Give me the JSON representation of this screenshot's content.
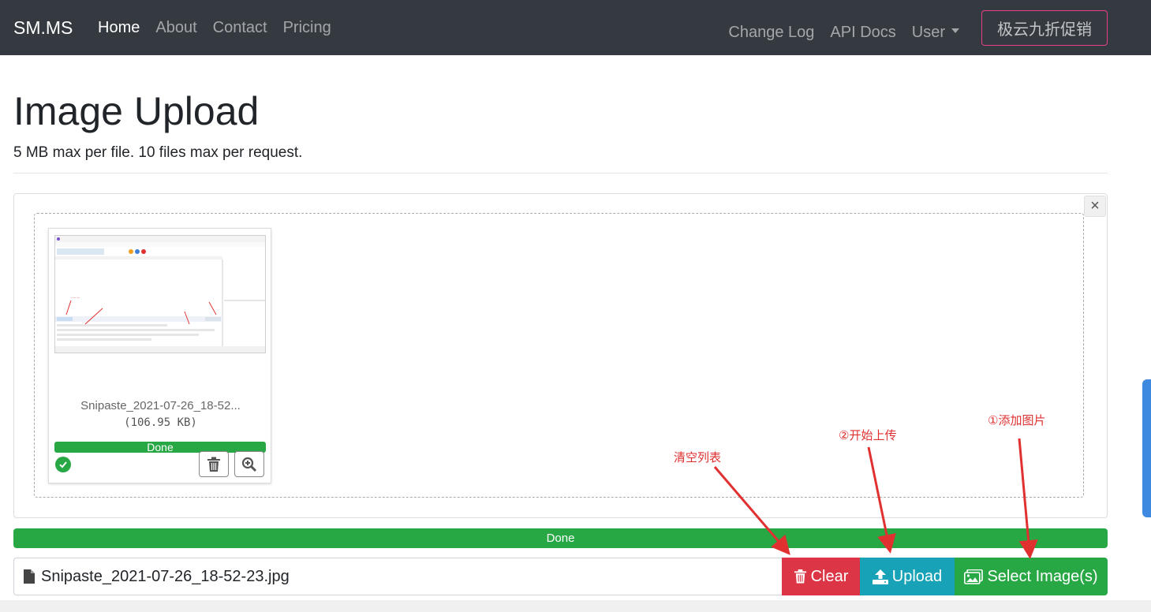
{
  "navbar": {
    "brand": "SM.MS",
    "left_links": [
      "Home",
      "About",
      "Contact",
      "Pricing"
    ],
    "right_links": {
      "changelog": "Change Log",
      "api_docs": "API Docs",
      "user": "User"
    },
    "promo_button": "极云九折促销"
  },
  "header": {
    "title": "Image Upload",
    "subtitle": "5 MB max per file. 10 files max per request."
  },
  "preview": {
    "file_name": "Snipaste_2021-07-26_18-52...",
    "file_size": "(106.95 KB)",
    "progress_label": "Done",
    "progress_percent": 100,
    "close_symbol": "×"
  },
  "upload": {
    "progress_label": "Done",
    "progress_percent": 100,
    "selected_file": "Snipaste_2021-07-26_18-52-23.jpg",
    "clear_label": "Clear",
    "upload_label": "Upload",
    "select_label": "Select Image(s)"
  },
  "annotations": {
    "clear": "清空列表",
    "upload": "②开始上传",
    "select": "①添加图片"
  },
  "colors": {
    "navbar_bg": "#343a40",
    "danger": "#dc3545",
    "info": "#17a2b8",
    "success": "#28a745",
    "annotation": "#e03030",
    "promo_border": "#e83e8c"
  },
  "icons": {
    "file": "file-icon",
    "trash": "trash-icon",
    "upload": "upload-icon",
    "images": "images-icon",
    "check": "check-circle-icon",
    "zoom": "zoom-in-icon",
    "caret": "caret-down-icon",
    "close": "close-icon"
  }
}
